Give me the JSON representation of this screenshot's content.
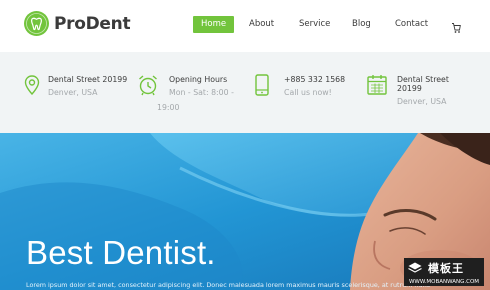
{
  "brand": {
    "name": "ProDent"
  },
  "nav": {
    "items": [
      {
        "label": "Home",
        "active": true
      },
      {
        "label": "About"
      },
      {
        "label": "Service"
      },
      {
        "label": "Blog"
      },
      {
        "label": "Contact"
      }
    ],
    "cart_icon": "cart-icon"
  },
  "info": [
    {
      "icon": "location-pin-icon",
      "title": "Dental Street 20199",
      "sub": "Denver, USA"
    },
    {
      "icon": "alarm-clock-icon",
      "title": "Opening Hours",
      "sub1": "Mon - Sat: 8:00 -",
      "sub2": "19:00"
    },
    {
      "icon": "mobile-phone-icon",
      "title": "+885 332 1568",
      "sub": "Call us now!"
    },
    {
      "icon": "calendar-icon",
      "title1": "Dental Street",
      "title2": "20199",
      "sub": "Denver, USA"
    }
  ],
  "hero": {
    "heading": "Best Dentist.",
    "text": "Lorem ipsum dolor sit amet, consectetur adipiscing elit. Donec malesuada lorem maximus mauris scelerisque, at rutrum nulla"
  },
  "watermark": {
    "cn": "模板王",
    "url": "WWW.MOBANWANG.COM"
  },
  "colors": {
    "accent": "#72c43c",
    "hero_blue": "#2a9bd8",
    "info_bg": "#f1f4f5"
  }
}
